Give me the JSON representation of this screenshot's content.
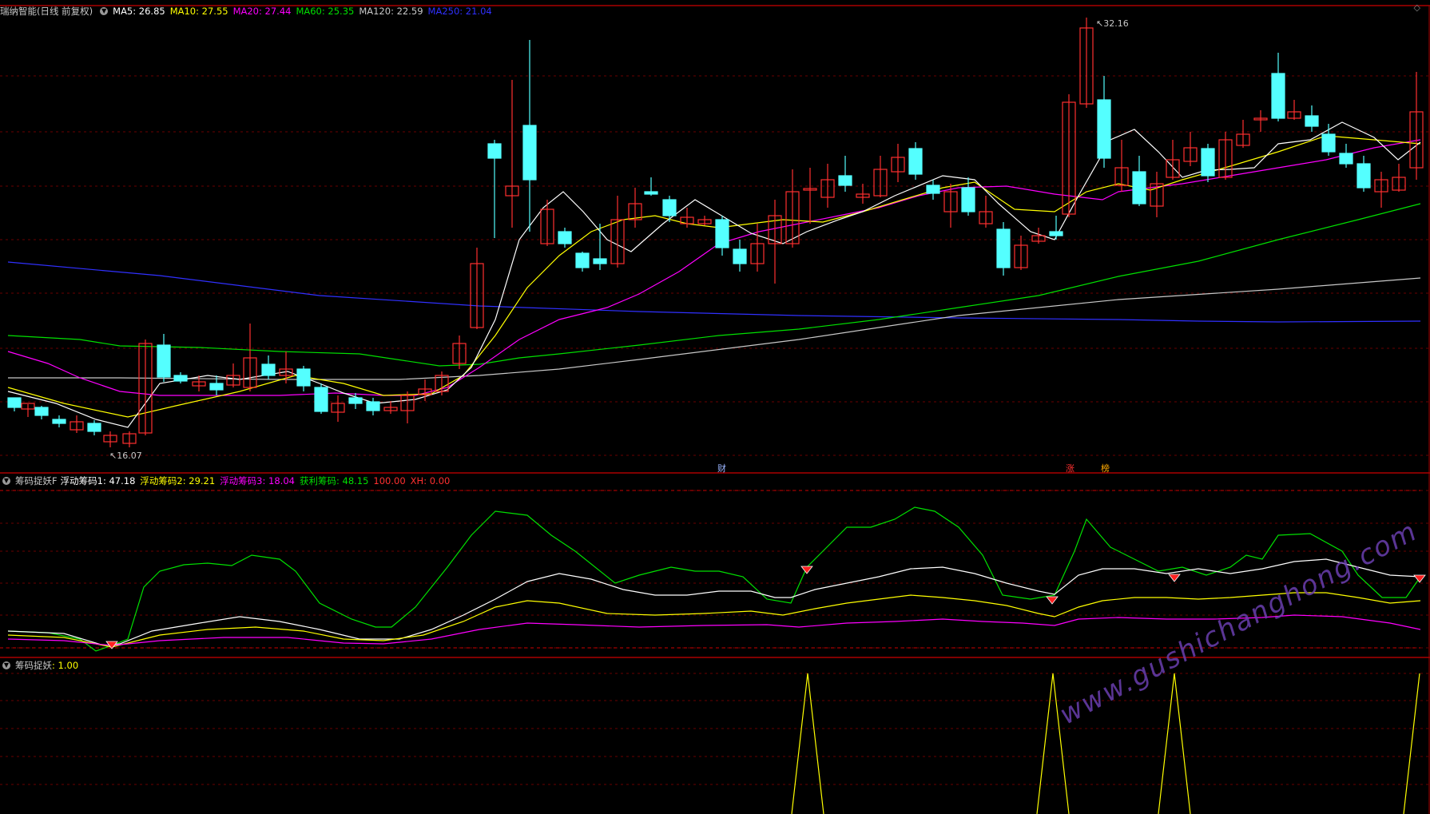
{
  "panels": {
    "main": {
      "title": "瑞纳智能(日线 前复权)",
      "indicators": [
        {
          "label": "MA5: 26.85",
          "color": "#ffffff"
        },
        {
          "label": "MA10: 27.55",
          "color": "#ffff00"
        },
        {
          "label": "MA20: 27.44",
          "color": "#ff00ff"
        },
        {
          "label": "MA60: 25.35",
          "color": "#00e000"
        },
        {
          "label": "MA120: 22.59",
          "color": "#c8c8c8"
        },
        {
          "label": "MA250: 21.04",
          "color": "#3030ff"
        }
      ],
      "high_marker": "32.16",
      "low_marker": "16.07",
      "signals": [
        {
          "text": "财",
          "color": "#9ab4ff"
        },
        {
          "text": "涨",
          "color": "#ff3030"
        },
        {
          "text": "榜",
          "color": "#ffaa00"
        }
      ]
    },
    "sub1": {
      "title": "筹码捉妖F",
      "values": [
        {
          "label": "浮动筹码1: 47.18",
          "color": "#ffffff"
        },
        {
          "label": "浮动筹码2: 29.21",
          "color": "#ffff00"
        },
        {
          "label": "浮动筹码3: 18.04",
          "color": "#ff00ff"
        },
        {
          "label": "获利筹码: 48.15",
          "color": "#00e000"
        },
        {
          "label": "100.00",
          "color": "#ff3030"
        },
        {
          "label": "XH: 0.00",
          "color": "#ff3030"
        }
      ]
    },
    "sub2": {
      "title": "筹码捉妖",
      "value": ": 1.00"
    }
  },
  "colors": {
    "up": "#ff3030",
    "down": "#54ffff",
    "grid": "#7a0000",
    "ma5": "#ffffff",
    "ma10": "#ffff00",
    "ma20": "#ff00ff",
    "ma60": "#00e000",
    "ma120": "#c8c8c8",
    "ma250": "#3030ff"
  },
  "watermark": "www.gushichanghong.com"
}
